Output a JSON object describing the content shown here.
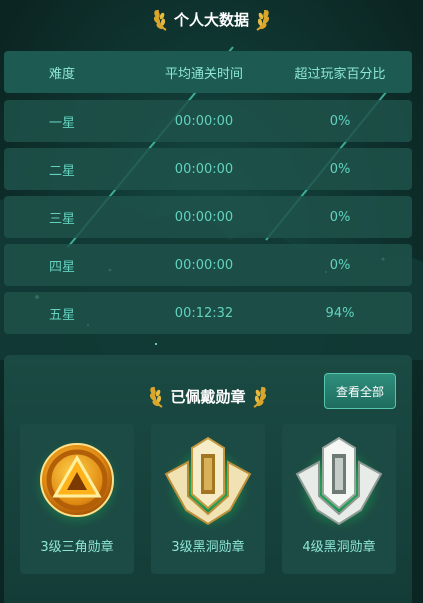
{
  "personal_stats": {
    "title": "个人大数据",
    "headers": [
      "难度",
      "平均通关时间",
      "超过玩家百分比"
    ],
    "rows": [
      {
        "difficulty": "一星",
        "avg_time": "00:00:00",
        "percent": "0%"
      },
      {
        "difficulty": "二星",
        "avg_time": "00:00:00",
        "percent": "0%"
      },
      {
        "difficulty": "三星",
        "avg_time": "00:00:00",
        "percent": "0%"
      },
      {
        "difficulty": "四星",
        "avg_time": "00:00:00",
        "percent": "0%"
      },
      {
        "difficulty": "五星",
        "avg_time": "00:12:32",
        "percent": "94%"
      }
    ]
  },
  "medals": {
    "title": "已佩戴勋章",
    "view_all_label": "查看全部",
    "items": [
      {
        "name": "3级三角勋章",
        "icon": "triangle-medal-icon"
      },
      {
        "name": "3级黑洞勋章",
        "icon": "gold-blackhole-medal-icon"
      },
      {
        "name": "4级黑洞勋章",
        "icon": "silver-blackhole-medal-icon"
      }
    ]
  },
  "colors": {
    "background": "#0d2a26",
    "row": "#1e524a",
    "text": "#62d2bf",
    "gold": "#d9a52a",
    "button": "#2f8f7c"
  }
}
